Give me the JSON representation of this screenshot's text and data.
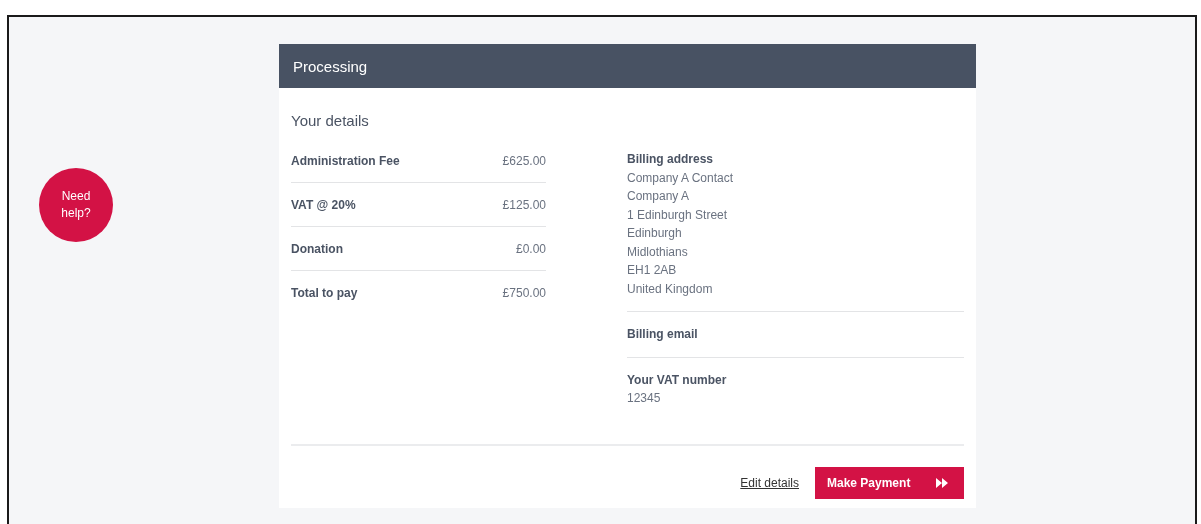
{
  "help_button": {
    "label": "Need help?"
  },
  "panel": {
    "title": "Processing",
    "section_title": "Your details"
  },
  "charges": [
    {
      "label": "Administration Fee",
      "amount": "£625.00"
    },
    {
      "label": "VAT @ 20%",
      "amount": "£125.00"
    },
    {
      "label": "Donation",
      "amount": "£0.00"
    },
    {
      "label": "Total to pay",
      "amount": "£750.00"
    }
  ],
  "billing": [
    {
      "heading": "Billing address",
      "lines": [
        "Company A Contact",
        "Company A",
        "1 Edinburgh Street",
        "Edinburgh",
        "Midlothians",
        "EH1 2AB",
        "United Kingdom"
      ]
    },
    {
      "heading": "Billing email"
    },
    {
      "heading": "Your VAT number",
      "lines": [
        "12345"
      ]
    }
  ],
  "actions": {
    "edit_link": "Edit details",
    "pay_button": "Make Payment"
  }
}
